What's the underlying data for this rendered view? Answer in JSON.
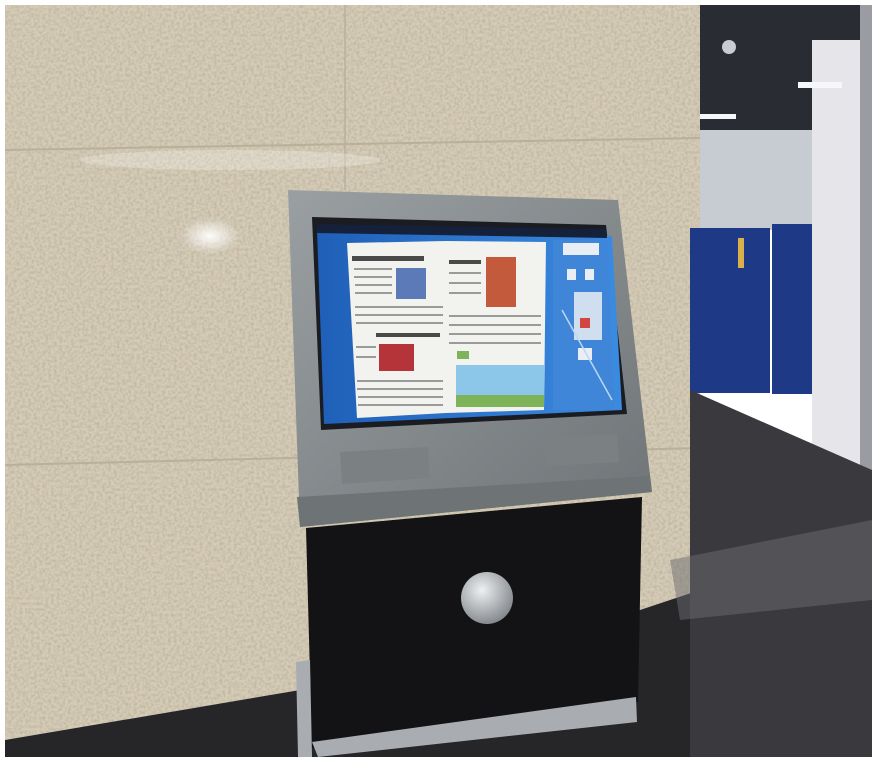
{
  "colors": {
    "frame_border": "#ffffff",
    "wall": "#d6ccb6",
    "wall_seam": "#b9b09c",
    "floor_left": "#262528",
    "floor_right": "#3a3a3e",
    "ceiling": "#2a2c33",
    "corridor_wall": "#c7cbd2",
    "blue_panel": "#1e3a86",
    "pillar": "#e6e6ea",
    "ceiling_light": "#f5f7fb",
    "kiosk_frame": "#8c9194",
    "kiosk_frame_edge": "#6e7376",
    "bezel": "#1a1c21",
    "screen_bg": "#2c73cf",
    "screen_topbar": "#15203a",
    "page": "#f2f2ee",
    "text_line": "#9a9a9a",
    "headline": "#4a4a4a",
    "photo_portrait": "#5c79b8",
    "photo_athlete": "#c45a3c",
    "photo_car": "#b4343a",
    "photo_landscape": "#8cc6e8",
    "photo_grass": "#7fb35a",
    "control_panel": "#3f86d8",
    "control_button": "#e9eef5",
    "grille": "#7b8083",
    "cabinet": "#131315",
    "base": "#a9adb1",
    "round_button": "#bfc3c7"
  },
  "icons": {
    "camera": "ceiling-camera-icon",
    "round_button": "kiosk-round-button-icon"
  }
}
